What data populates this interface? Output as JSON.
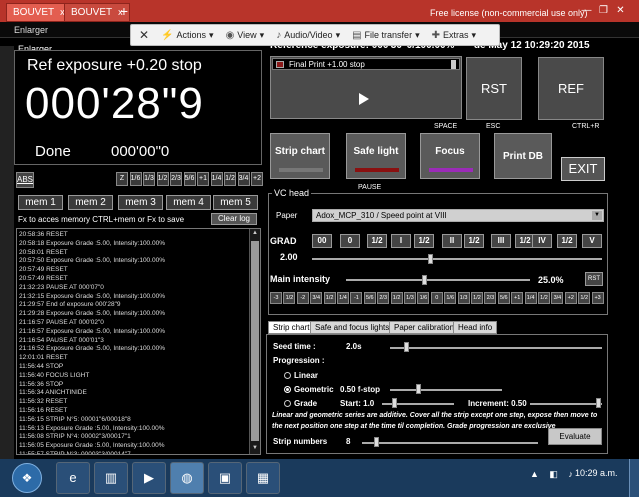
{
  "browser": {
    "tabs": [
      "BOUVET",
      "BOUVET"
    ],
    "license": "Free license (non-commercial use only)",
    "new_tab": "+",
    "close_icon": "x"
  },
  "window": {
    "title": "Enlarger"
  },
  "toolbar": {
    "close": "✕",
    "items": [
      {
        "label": "Actions",
        "icon": "lightning-icon"
      },
      {
        "label": "View",
        "icon": "eye-icon"
      },
      {
        "label": "Audio/Video",
        "icon": "speaker-icon"
      },
      {
        "label": "File transfer",
        "icon": "folder-icon"
      },
      {
        "label": "Extras",
        "icon": "wrench-icon"
      }
    ],
    "caret": "▾"
  },
  "status": {
    "ref_exposure": "Reference exposure: 000'30\"0/100.00%",
    "date": "de May 12 10:29:20 2015"
  },
  "enlarger": {
    "label": "Enlarger",
    "ref_exp": "Ref exposure +0.20 stop",
    "timer": "000'28\"9",
    "done_label": "Done",
    "done_value": "000'00\"0"
  },
  "steps": {
    "abs": "ABS",
    "buttons": [
      "Z",
      "1/6",
      "1/3",
      "1/2",
      "2/3",
      "5/6",
      "+1",
      "1/4",
      "1/2",
      "3/4",
      "+2"
    ]
  },
  "memory": {
    "buttons": [
      "mem 1",
      "mem 2",
      "mem 3",
      "mem 4",
      "mem 5"
    ],
    "hint": "Fx to acces memory   CTRL+mem or Fx to save",
    "clear": "Clear log"
  },
  "log": [
    "20:58:36 RESET",
    "20:58:18 Exposure Grade :5.00, Intensity:100.00%",
    "20:58:01 RESET",
    "20:57:50 Exposure Grade :5.00, Intensity:100.00%",
    "20:57:49 RESET",
    "20:57:49 RESET",
    "21:32:23 PAUSE AT 000'07\"0",
    "21:32:15 Exposure Grade :5.00, Intensity:100.00%",
    "21:29:57 End of exposure 000'28\"9",
    "21:29:28 Exposure Grade :5.00, Intensity:100.00%",
    "21:16:57 PAUSE AT 000'02\"0",
    "21:16:57 Exposure Grade :5.00, Intensity:100.00%",
    "21:16:54 PAUSE AT 000'01\"3",
    "21:16:52 Exposure Grade :5.00, Intensity:100.00%",
    "12:01:01 RESET",
    "11:56:44 STOP",
    "11:56:40 FOCUS LIGHT",
    "11:56:36 STOP",
    "11:56:34 ANICHTINIDE",
    "11:56:32 RESET",
    "11:56:16 RESET",
    "11:56:15 STRIP N°5: 00001\"6/00018\"8",
    "11:56:13 Exposure Grade :5.00, Intensity:100.00%",
    "11:56:08 STRIP N°4: 00002\"3/00017\"1",
    "11:56:05 Exposure Grade :5.00, Intensity:100.00%",
    "11:55:57 STRIP N°3: 00003\"3/00014\"7",
    "11:55:53 Exposure Grade :5.00, Intensity:100.00%"
  ],
  "controls": {
    "print_label": "Final Print +1.00 stop",
    "space": "SPACE",
    "rst": "RST",
    "esc": "ESC",
    "ref": "REF",
    "ctrlr": "CTRL+R",
    "strip_chart": "Strip chart",
    "safe_light": "Safe light",
    "focus": "Focus",
    "pause": "PAUSE",
    "print_db": "Print DB",
    "exit": "EXIT"
  },
  "vc_head": {
    "legend": "VC head",
    "paper_label": "Paper",
    "paper_value": "Adox_MCP_310 / Speed point at VIII",
    "grad_label": "GRAD",
    "grad_buttons": [
      "00",
      "0",
      "1/2",
      "I",
      "1/2",
      "II",
      "1/2",
      "III",
      "1/2",
      "IV",
      "1/2",
      "V"
    ],
    "grad_value": "2.00",
    "grad_level": 0.4,
    "intensity_label": "Main intensity",
    "intensity_value": "25.0%",
    "intensity_level": 0.25,
    "rst": "RST",
    "stops": [
      "-3",
      "1/2",
      "-2",
      "3/4",
      "1/2",
      "1/4",
      "-1",
      "5/6",
      "2/3",
      "1/2",
      "1/3",
      "1/6",
      "0",
      "1/6",
      "1/3",
      "1/2",
      "2/3",
      "5/6",
      "+1",
      "1/4",
      "1/2",
      "3/4",
      "+2",
      "1/2",
      "+3"
    ]
  },
  "tabs": [
    "Strip chart",
    "Safe and focus lights",
    "Paper calibration",
    "Head info"
  ],
  "strip": {
    "seed_label": "Seed time :",
    "seed_value": "2.0s",
    "progression": "Progression :",
    "linear": "Linear",
    "geometric": "Geometric",
    "geometric_value": "0.50 f-stop",
    "grade": "Grade",
    "start_label": "Start: 1.0",
    "increment_label": "Increment: 0.50",
    "note": "Linear and geometric series are additive. Cover all the strip except one step, expose then move to the next position one step at the time til completion. Grade progression are exclusive",
    "strip_label": "Strip numbers",
    "strip_value": "8",
    "evaluate": "Evaluate"
  },
  "taskbar": {
    "clock": "10:29 a.m."
  }
}
